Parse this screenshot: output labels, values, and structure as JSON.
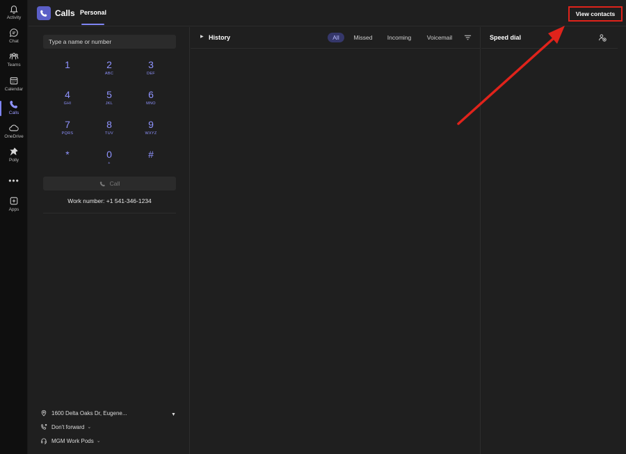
{
  "rail": {
    "items": [
      {
        "label": "Activity",
        "icon": "bell-icon"
      },
      {
        "label": "Chat",
        "icon": "chat-icon"
      },
      {
        "label": "Teams",
        "icon": "teams-icon"
      },
      {
        "label": "Calendar",
        "icon": "calendar-icon"
      },
      {
        "label": "Calls",
        "icon": "phone-icon",
        "active": true
      },
      {
        "label": "OneDrive",
        "icon": "cloud-icon"
      },
      {
        "label": "Polly",
        "icon": "polly-icon"
      },
      {
        "label": "Apps",
        "icon": "apps-icon"
      }
    ],
    "more": "•••"
  },
  "header": {
    "title": "Calls",
    "tab": "Personal",
    "view_contacts": "View contacts"
  },
  "dialpad": {
    "placeholder": "Type a name or number",
    "keys": [
      {
        "digit": "1",
        "letters": ""
      },
      {
        "digit": "2",
        "letters": "ABC"
      },
      {
        "digit": "3",
        "letters": "DEF"
      },
      {
        "digit": "4",
        "letters": "GHI"
      },
      {
        "digit": "5",
        "letters": "JKL"
      },
      {
        "digit": "6",
        "letters": "MNO"
      },
      {
        "digit": "7",
        "letters": "PQRS"
      },
      {
        "digit": "8",
        "letters": "TUV"
      },
      {
        "digit": "9",
        "letters": "WXYZ"
      },
      {
        "digit": "*",
        "letters": ""
      },
      {
        "digit": "0",
        "letters": "+"
      },
      {
        "digit": "#",
        "letters": ""
      }
    ],
    "call_label": "Call",
    "work_number": "Work number: +1 541-346-1234",
    "location": "1600 Delta Oaks Dr, Eugene...",
    "forward": "Don't forward",
    "device": "MGM Work Pods"
  },
  "history": {
    "title": "History",
    "filters": [
      "All",
      "Missed",
      "Incoming",
      "Voicemail"
    ],
    "active_filter": "All"
  },
  "speed_dial": {
    "title": "Speed dial"
  },
  "colors": {
    "accent": "#7f85f5",
    "annotation": "#e0231b",
    "background": "#1f1f1f",
    "rail": "#0f0f0f"
  }
}
